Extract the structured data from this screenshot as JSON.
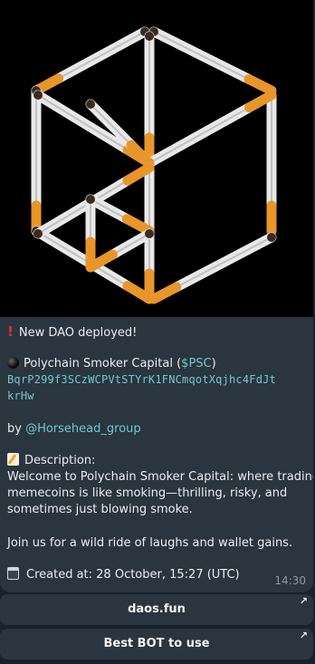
{
  "message": {
    "alert_text": "New DAO deployed!",
    "alert_icon": "red-exclamation-icon",
    "token_icon": "black-circle-icon",
    "token_name": "Polychain Smoker Capital (",
    "ticker": "$PSC",
    "token_name_close": ")",
    "address_line1": "BqrP299f3SCzWCPVtSTYrK1FNCmqotXqjhc4FdJt",
    "address_line2": "krHw",
    "by_prefix": "by ",
    "author": "@Horsehead_group",
    "description_icon": "memo-icon",
    "description_label": "Description:",
    "description_lines": [
      "Welcome to Polychain Smoker Capital: where trading",
      "memecoins is like smoking—thrilling, risky, and",
      "sometimes just blowing smoke."
    ],
    "closing_line": "Join us for a wild ride of laughs and wallet gains.",
    "created_icon": "calendar-icon",
    "created_text": "Created at: 28 October, 15:27 (UTC)",
    "time": "14:30"
  },
  "buttons": [
    {
      "label": "daos.fun",
      "icon": "external-arrow-icon"
    },
    {
      "label": "Best BOT to use",
      "icon": "external-arrow-icon"
    }
  ],
  "colors": {
    "background": "#18222d",
    "bubble": "#2b353f",
    "link": "#6ec9cf"
  }
}
